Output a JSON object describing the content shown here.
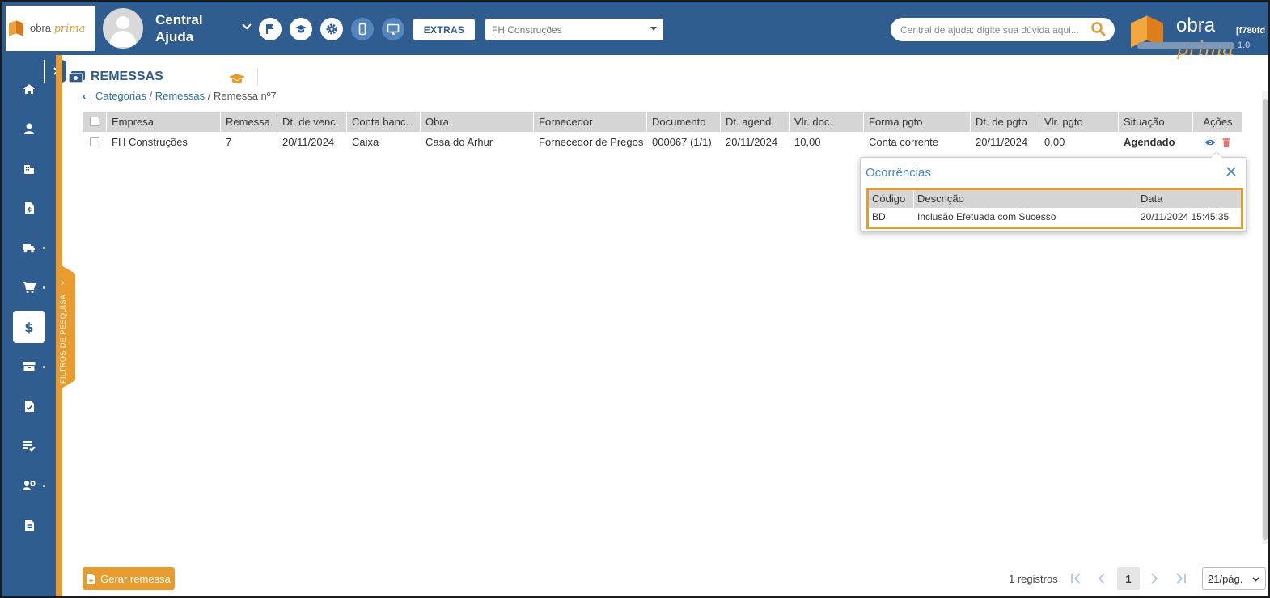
{
  "header": {
    "logo_text": "obra",
    "logo_script": "prima",
    "user_name": "Central Ajuda",
    "extras_label": "EXTRAS",
    "company_select_value": "FH Construções",
    "help_search_placeholder": "Central de ajuda: digite sua dúvida aqui...",
    "brand_text": "obra",
    "brand_script": "prima",
    "brand_code": "[f780fd",
    "brand_version": "1.0"
  },
  "sidebar": {
    "filter_tab_label": "FILTROS DE PESQUISA",
    "items": [
      "home-icon",
      "person-icon",
      "buildings-icon",
      "document-money-icon",
      "truck-icon",
      "cart-icon",
      "dollar-icon",
      "archive-icon",
      "document-check-icon",
      "list-check-icon",
      "people-settings-icon",
      "document-icon"
    ]
  },
  "page": {
    "title": "REMESSAS",
    "breadcrumb": {
      "item1": "Categorias",
      "sep1": "/",
      "item2": "Remessas",
      "sep2": "/",
      "current": "Remessa nº7"
    }
  },
  "table": {
    "headers": [
      "Empresa",
      "Remessa",
      "Dt. de venc.",
      "Conta banc...",
      "Obra",
      "Fornecedor",
      "Documento",
      "Dt. agend.",
      "Vlr. doc.",
      "Forma pgto",
      "Dt. de pgto",
      "Vlr. pgto",
      "Situação",
      "Ações"
    ],
    "rows": [
      {
        "empresa": "FH Construções",
        "remessa": "7",
        "dt_venc": "20/11/2024",
        "conta": "Caixa",
        "obra": "Casa do Arhur",
        "fornecedor": "Fornecedor de Pregos",
        "documento": "000067 (1/1)",
        "dt_agend": "20/11/2024",
        "vlr_doc": "10,00",
        "forma_pgto": "Conta corrente",
        "dt_pgto": "20/11/2024",
        "vlr_pgto": "0,00",
        "situacao": "Agendado"
      }
    ]
  },
  "popover": {
    "title": "Ocorrências",
    "headers": [
      "Código",
      "Descrição",
      "Data"
    ],
    "rows": [
      {
        "codigo": "BD",
        "descricao": "Inclusão Efetuada com Sucesso",
        "data": "20/11/2024 15:45:35"
      }
    ]
  },
  "footer": {
    "generate_label": "Gerar remessa",
    "records": "1 registros",
    "current_page": "1",
    "per_page": "21/pág."
  },
  "colors": {
    "primary": "#2f5d8f",
    "accent": "#e89b2f",
    "link": "#3a7bbf",
    "status_agendado": "#e08a1e"
  }
}
